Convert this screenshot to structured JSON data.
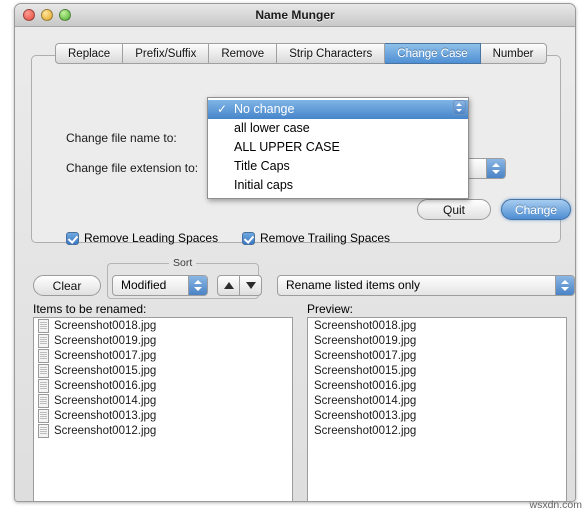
{
  "window": {
    "title": "Name Munger",
    "traffic_lights": [
      "close",
      "minimize",
      "zoom"
    ]
  },
  "tabs": [
    {
      "label": "Replace",
      "active": false
    },
    {
      "label": "Prefix/Suffix",
      "active": false
    },
    {
      "label": "Remove",
      "active": false
    },
    {
      "label": "Strip Characters",
      "active": false
    },
    {
      "label": "Change Case",
      "active": true
    },
    {
      "label": "Number",
      "active": false
    }
  ],
  "change_case": {
    "file_name_label": "Change file name to:",
    "file_extension_label": "Change file extension to:",
    "file_extension_value": "",
    "menu": {
      "selected": "No change",
      "check_glyph": "✓",
      "items": [
        "No change",
        "all lower case",
        "ALL UPPER CASE",
        "Title Caps",
        "Initial caps"
      ]
    },
    "remove_leading_spaces": "Remove Leading Spaces",
    "remove_trailing_spaces": "Remove Trailing Spaces",
    "quit_label": "Quit",
    "change_label": "Change"
  },
  "controls": {
    "clear_label": "Clear",
    "sort_title": "Sort",
    "sort_value": "Modified",
    "sort_up_icon": "triangle-up",
    "sort_down_icon": "triangle-down",
    "scope_value": "Rename listed items only"
  },
  "lists": {
    "items_label": "Items to be renamed:",
    "preview_label": "Preview:",
    "items": [
      "Screenshot0018.jpg",
      "Screenshot0019.jpg",
      "Screenshot0017.jpg",
      "Screenshot0015.jpg",
      "Screenshot0016.jpg",
      "Screenshot0014.jpg",
      "Screenshot0013.jpg",
      "Screenshot0012.jpg"
    ],
    "preview": [
      "Screenshot0018.jpg",
      "Screenshot0019.jpg",
      "Screenshot0017.jpg",
      "Screenshot0015.jpg",
      "Screenshot0016.jpg",
      "Screenshot0014.jpg",
      "Screenshot0013.jpg",
      "Screenshot0012.jpg"
    ]
  },
  "watermark": "wsxdn.com",
  "colors": {
    "accent": "#4e8dd3",
    "window_bg": "#e6e6e6"
  }
}
